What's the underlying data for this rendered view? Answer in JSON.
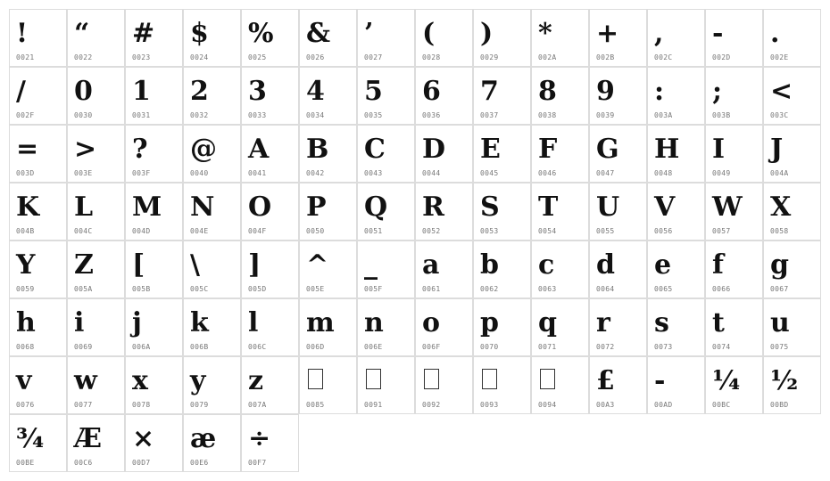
{
  "cells": [
    {
      "glyph": "!",
      "code": "0021"
    },
    {
      "glyph": "“",
      "code": "0022"
    },
    {
      "glyph": "#",
      "code": "0023"
    },
    {
      "glyph": "$",
      "code": "0024"
    },
    {
      "glyph": "%",
      "code": "0025"
    },
    {
      "glyph": "&",
      "code": "0026"
    },
    {
      "glyph": "’",
      "code": "0027"
    },
    {
      "glyph": "(",
      "code": "0028"
    },
    {
      "glyph": ")",
      "code": "0029"
    },
    {
      "glyph": "*",
      "code": "002A"
    },
    {
      "glyph": "+",
      "code": "002B"
    },
    {
      "glyph": ",",
      "code": "002C"
    },
    {
      "glyph": "-",
      "code": "002D"
    },
    {
      "glyph": ".",
      "code": "002E"
    },
    {
      "glyph": "/",
      "code": "002F"
    },
    {
      "glyph": "0",
      "code": "0030"
    },
    {
      "glyph": "1",
      "code": "0031"
    },
    {
      "glyph": "2",
      "code": "0032"
    },
    {
      "glyph": "3",
      "code": "0033"
    },
    {
      "glyph": "4",
      "code": "0034"
    },
    {
      "glyph": "5",
      "code": "0035"
    },
    {
      "glyph": "6",
      "code": "0036"
    },
    {
      "glyph": "7",
      "code": "0037"
    },
    {
      "glyph": "8",
      "code": "0038"
    },
    {
      "glyph": "9",
      "code": "0039"
    },
    {
      "glyph": ":",
      "code": "003A"
    },
    {
      "glyph": ";",
      "code": "003B"
    },
    {
      "glyph": "<",
      "code": "003C"
    },
    {
      "glyph": "=",
      "code": "003D"
    },
    {
      "glyph": ">",
      "code": "003E"
    },
    {
      "glyph": "?",
      "code": "003F"
    },
    {
      "glyph": "@",
      "code": "0040"
    },
    {
      "glyph": "A",
      "code": "0041"
    },
    {
      "glyph": "B",
      "code": "0042"
    },
    {
      "glyph": "C",
      "code": "0043"
    },
    {
      "glyph": "D",
      "code": "0044"
    },
    {
      "glyph": "E",
      "code": "0045"
    },
    {
      "glyph": "F",
      "code": "0046"
    },
    {
      "glyph": "G",
      "code": "0047"
    },
    {
      "glyph": "H",
      "code": "0048"
    },
    {
      "glyph": "I",
      "code": "0049"
    },
    {
      "glyph": "J",
      "code": "004A"
    },
    {
      "glyph": "K",
      "code": "004B"
    },
    {
      "glyph": "L",
      "code": "004C"
    },
    {
      "glyph": "M",
      "code": "004D"
    },
    {
      "glyph": "N",
      "code": "004E"
    },
    {
      "glyph": "O",
      "code": "004F"
    },
    {
      "glyph": "P",
      "code": "0050"
    },
    {
      "glyph": "Q",
      "code": "0051"
    },
    {
      "glyph": "R",
      "code": "0052"
    },
    {
      "glyph": "S",
      "code": "0053"
    },
    {
      "glyph": "T",
      "code": "0054"
    },
    {
      "glyph": "U",
      "code": "0055"
    },
    {
      "glyph": "V",
      "code": "0056"
    },
    {
      "glyph": "W",
      "code": "0057"
    },
    {
      "glyph": "X",
      "code": "0058"
    },
    {
      "glyph": "Y",
      "code": "0059"
    },
    {
      "glyph": "Z",
      "code": "005A"
    },
    {
      "glyph": "[",
      "code": "005B"
    },
    {
      "glyph": "\\",
      "code": "005C"
    },
    {
      "glyph": "]",
      "code": "005D"
    },
    {
      "glyph": "^",
      "code": "005E"
    },
    {
      "glyph": "_",
      "code": "005F"
    },
    {
      "glyph": "a",
      "code": "0061"
    },
    {
      "glyph": "b",
      "code": "0062"
    },
    {
      "glyph": "c",
      "code": "0063"
    },
    {
      "glyph": "d",
      "code": "0064"
    },
    {
      "glyph": "e",
      "code": "0065"
    },
    {
      "glyph": "f",
      "code": "0066"
    },
    {
      "glyph": "g",
      "code": "0067"
    },
    {
      "glyph": "h",
      "code": "0068"
    },
    {
      "glyph": "i",
      "code": "0069"
    },
    {
      "glyph": "j",
      "code": "006A"
    },
    {
      "glyph": "k",
      "code": "006B"
    },
    {
      "glyph": "l",
      "code": "006C"
    },
    {
      "glyph": "m",
      "code": "006D"
    },
    {
      "glyph": "n",
      "code": "006E"
    },
    {
      "glyph": "o",
      "code": "006F"
    },
    {
      "glyph": "p",
      "code": "0070"
    },
    {
      "glyph": "q",
      "code": "0071"
    },
    {
      "glyph": "r",
      "code": "0072"
    },
    {
      "glyph": "s",
      "code": "0073"
    },
    {
      "glyph": "t",
      "code": "0074"
    },
    {
      "glyph": "u",
      "code": "0075"
    },
    {
      "glyph": "v",
      "code": "0076"
    },
    {
      "glyph": "w",
      "code": "0077"
    },
    {
      "glyph": "x",
      "code": "0078"
    },
    {
      "glyph": "y",
      "code": "0079"
    },
    {
      "glyph": "z",
      "code": "007A"
    },
    {
      "glyph": "",
      "code": "0085",
      "notdef": true
    },
    {
      "glyph": "",
      "code": "0091",
      "notdef": true
    },
    {
      "glyph": "",
      "code": "0092",
      "notdef": true
    },
    {
      "glyph": "",
      "code": "0093",
      "notdef": true
    },
    {
      "glyph": "",
      "code": "0094",
      "notdef": true
    },
    {
      "glyph": "£",
      "code": "00A3"
    },
    {
      "glyph": "-",
      "code": "00AD"
    },
    {
      "glyph": "¼",
      "code": "00BC"
    },
    {
      "glyph": "½",
      "code": "00BD"
    },
    {
      "glyph": "¾",
      "code": "00BE"
    },
    {
      "glyph": "Æ",
      "code": "00C6"
    },
    {
      "glyph": "×",
      "code": "00D7"
    },
    {
      "glyph": "æ",
      "code": "00E6"
    },
    {
      "glyph": "÷",
      "code": "00F7"
    }
  ]
}
